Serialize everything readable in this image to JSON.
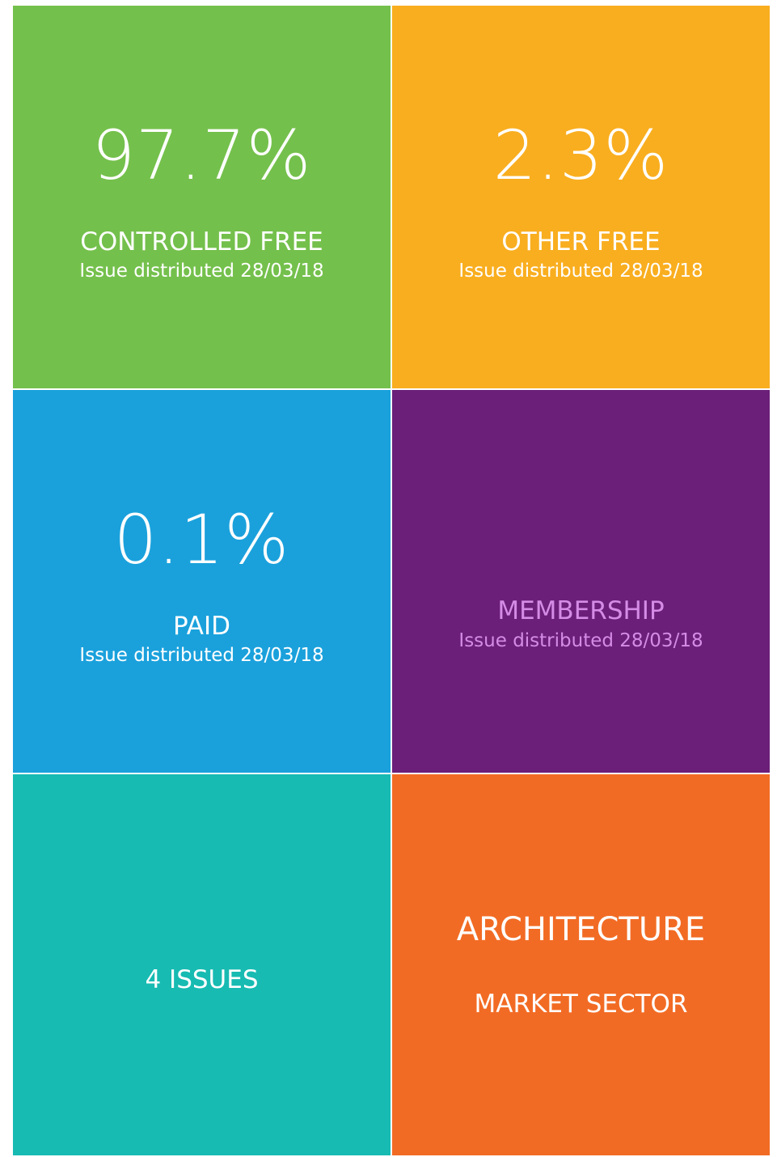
{
  "tiles": {
    "controlled_free": {
      "value": "97.7%",
      "label": "CONTROLLED FREE",
      "sub": "Issue distributed 28/03/18",
      "color": "#74c04c"
    },
    "other_free": {
      "value": "2.3%",
      "label": "OTHER FREE",
      "sub": "Issue distributed 28/03/18",
      "color": "#f9ae1f"
    },
    "paid": {
      "value": "0.1%",
      "label": "PAID",
      "sub": "Issue distributed 28/03/18",
      "color": "#1aa1dc"
    },
    "membership": {
      "label": "MEMBERSHIP",
      "sub": "Issue distributed 28/03/18",
      "color": "#6b1f78",
      "text_color": "#d48ce6"
    },
    "issues": {
      "label": "4 ISSUES",
      "color": "#17bbb2"
    },
    "sector": {
      "value": "ARCHITECTURE",
      "label": "MARKET SECTOR",
      "color": "#f26b24"
    }
  }
}
